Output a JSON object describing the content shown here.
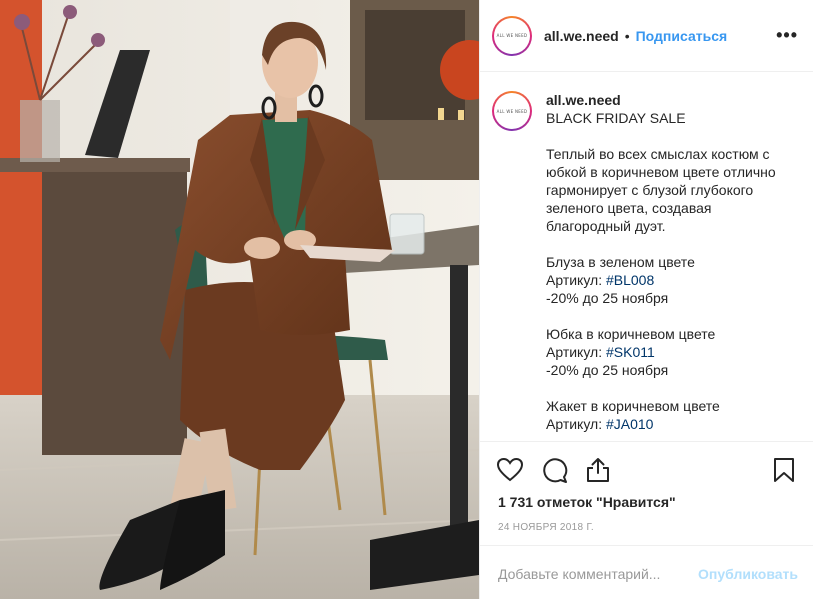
{
  "post": {
    "image_alt": "Woman in a brown suit with a green blouse sitting at a table in a cafe",
    "accent_color": "#3897f0"
  },
  "header": {
    "avatar_text": "ALL WE NEED",
    "username": "all.we.need",
    "separator": "•",
    "follow_label": "Подписаться",
    "more_label": "•••"
  },
  "caption": {
    "username": "all.we.need",
    "title": "BLACK FRIDAY SALE",
    "description": "Теплый во всех смыслах костюм с юбкой в коричневом цвете отлично гармонирует с блузой глубокого зеленого цвета, создавая благородный дуэт.",
    "items": [
      {
        "name": "Блуза в зеленом цвете",
        "article_label": "Артикул: ",
        "hashtag": "#BL008",
        "discount": "-20% до 25 ноября"
      },
      {
        "name": "Юбка в коричневом цвете",
        "article_label": "Артикул: ",
        "hashtag": "#SK011",
        "discount": "-20% до 25 ноября"
      },
      {
        "name": "Жакет в коричневом цвете",
        "article_label": "Артикул: ",
        "hashtag": "#JA010"
      }
    ]
  },
  "actions": {
    "icons": [
      "heart-icon",
      "comment-icon",
      "share-icon",
      "bookmark-icon"
    ],
    "likes": "1 731 отметок \"Нравится\"",
    "date": "24 ноября 2018 г."
  },
  "comment": {
    "placeholder": "Добавьте комментарий...",
    "publish_label": "Опубликовать",
    "publish_color": "#b2dffc"
  }
}
